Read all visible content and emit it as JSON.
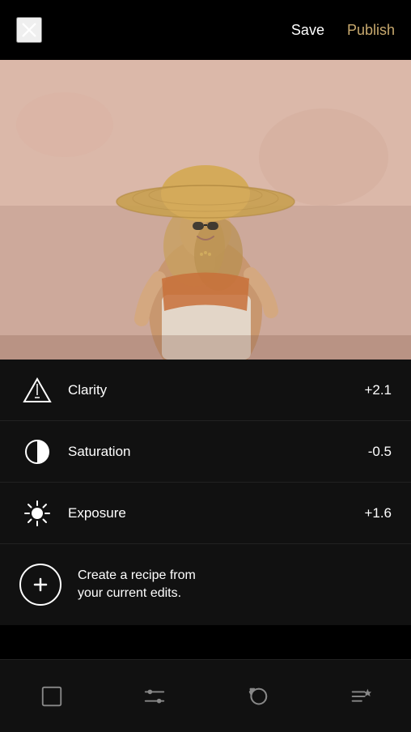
{
  "header": {
    "close_label": "×",
    "save_label": "Save",
    "publish_label": "Publish"
  },
  "adjustments": [
    {
      "id": "clarity",
      "label": "Clarity",
      "value": "+2.1",
      "icon": "clarity-icon"
    },
    {
      "id": "saturation",
      "label": "Saturation",
      "value": "-0.5",
      "icon": "saturation-icon"
    },
    {
      "id": "exposure",
      "label": "Exposure",
      "value": "+1.6",
      "icon": "exposure-icon"
    }
  ],
  "recipe": {
    "text_line1": "Create a recipe from",
    "text_line2": "your current edits."
  },
  "bottom_nav": {
    "items": [
      {
        "id": "frames",
        "icon": "frames-icon"
      },
      {
        "id": "adjustments",
        "icon": "sliders-icon"
      },
      {
        "id": "history",
        "icon": "history-icon"
      },
      {
        "id": "recipes",
        "icon": "recipes-icon"
      }
    ]
  },
  "colors": {
    "accent": "#c8a96e",
    "background": "#000000",
    "panel_bg": "#111111",
    "text_primary": "#ffffff",
    "divider": "#222222"
  }
}
